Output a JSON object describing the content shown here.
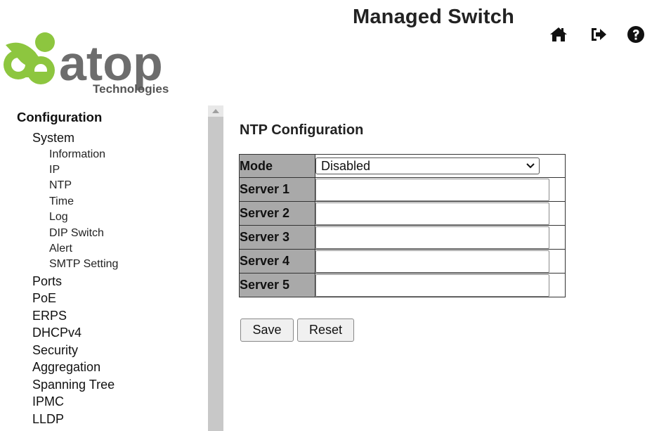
{
  "header": {
    "app_title": "Managed Switch",
    "logo_text": "atop",
    "logo_subtext": "Technologies",
    "icons": [
      "home-icon",
      "logout-icon",
      "help-icon"
    ]
  },
  "sidebar": {
    "root": "Configuration",
    "items": [
      {
        "label": "System",
        "children": [
          "Information",
          "IP",
          "NTP",
          "Time",
          "Log",
          "DIP Switch",
          "Alert",
          "SMTP Setting"
        ]
      },
      {
        "label": "Ports"
      },
      {
        "label": "PoE"
      },
      {
        "label": "ERPS"
      },
      {
        "label": "DHCPv4"
      },
      {
        "label": "Security"
      },
      {
        "label": "Aggregation"
      },
      {
        "label": "Spanning Tree"
      },
      {
        "label": "IPMC"
      },
      {
        "label": "LLDP"
      }
    ]
  },
  "main": {
    "title": "NTP Configuration",
    "mode": {
      "label": "Mode",
      "value": "Disabled"
    },
    "servers": [
      {
        "label": "Server 1",
        "value": ""
      },
      {
        "label": "Server 2",
        "value": ""
      },
      {
        "label": "Server 3",
        "value": ""
      },
      {
        "label": "Server 4",
        "value": ""
      },
      {
        "label": "Server 5",
        "value": ""
      }
    ],
    "buttons": {
      "save": "Save",
      "reset": "Reset"
    }
  },
  "colors": {
    "logo_green": "#8dc63f",
    "logo_gray": "#6d6d6d",
    "label_bg": "#a9a9a9",
    "scrollbar": "#c8c8c8"
  }
}
